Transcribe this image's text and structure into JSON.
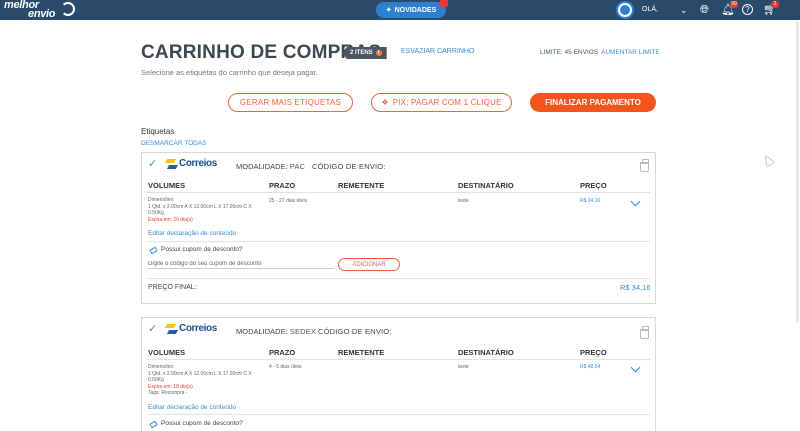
{
  "topbar": {
    "logo_line1": "melhor",
    "logo_line2": "envio",
    "novidades": "NOVIDADES",
    "greeting": "OLÁ,",
    "bell_badge": "99",
    "cart_badge": "2",
    "bg_color": "#2a4a6c"
  },
  "header": {
    "title": "CARRINHO DE COMPRAS",
    "items_badge": "2 ITENS",
    "empty_cart": "ESVAZIAR CARRINHO",
    "limit": "LIMITE: 45 ENVIOS",
    "raise_limit": "AUMENTAR LIMITE",
    "subtitle": "Selecione as etiquetas do carrinho que deseja pagar."
  },
  "actions": {
    "generate": "GERAR MAIS ETIQUETAS",
    "pix": "PIX: PAGAR COM 1 CLIQUE",
    "checkout": "FINALIZAR PAGAMENTO"
  },
  "labels": {
    "section_title": "Etiquetas",
    "deselect_all": "DESMARCAR TODAS"
  },
  "columns": [
    "VOLUMES",
    "PRAZO",
    "REMETENTE",
    "DESTINATÁRIO",
    "PREÇO"
  ],
  "cards": [
    {
      "carrier": "Correios",
      "modality_label": "MODALIDADE:",
      "modality": "PAC",
      "send_code": "CÓDIGO DE ENVIO:",
      "volume_title": "Dimensões:",
      "volume_line": "1 Qtd. x 2.00cm A X 12.00cm L X 17.00cm C X",
      "volume_weight": "0.50Kg",
      "expires": "Expira em: 20 dia(s)",
      "tags": "",
      "deadline": "25 - 27 dias úteis",
      "recipient": "teste",
      "price": "R$ 34,16",
      "edit_declaration": "Editar declaração de conteúdo",
      "coupon_question": "Possui cupom de desconto?",
      "coupon_placeholder": "Digite o código do seu cupom de desconto",
      "add_button": "ADICIONAR",
      "final_label": "PREÇO FINAL:",
      "final_price": "R$ 34,16"
    },
    {
      "carrier": "Correios",
      "modality_label": "MODALIDADE:",
      "modality": "SEDEX",
      "send_code": "CÓDIGO DE ENVIO:",
      "volume_title": "Dimensões:",
      "volume_line": "1 Qtd. x 2.00cm A X 12.00cm L X 17.00cm C X",
      "volume_weight": "0.50Kg",
      "expires": "Expira em: 18 dia(s)",
      "tags": "Tags: Recompra -",
      "deadline": "4 - 5 dias úteis",
      "recipient": "teste",
      "price": "R$ 48,54",
      "edit_declaration": "Editar declaração de conteúdo",
      "coupon_question": "Possui cupom de desconto?"
    }
  ]
}
